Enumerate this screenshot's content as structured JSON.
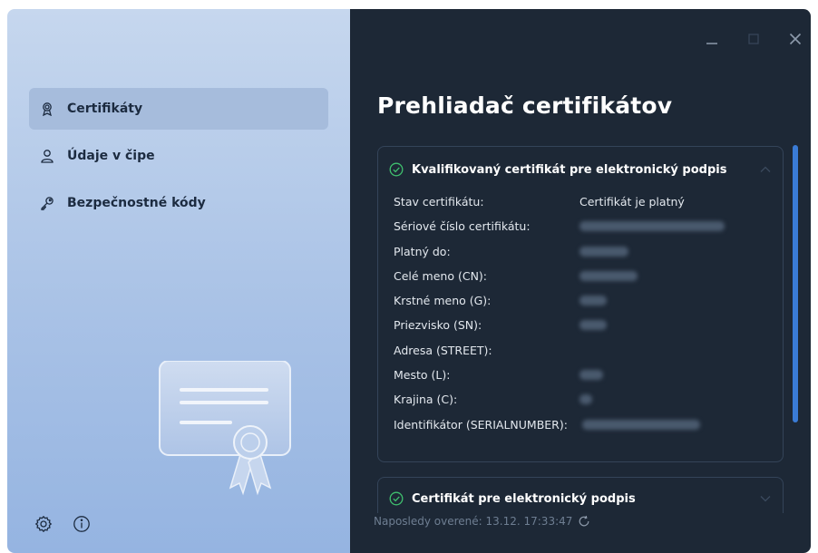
{
  "window": {
    "controls": [
      "minimize-icon",
      "maximize-icon",
      "close-icon"
    ]
  },
  "sidebar": {
    "items": [
      {
        "label": "Certifikáty",
        "icon": "certificate-icon",
        "active": true
      },
      {
        "label": "Údaje v čipe",
        "icon": "person-icon",
        "active": false
      },
      {
        "label": "Bezpečnostné kódy",
        "icon": "key-icon",
        "active": false
      }
    ],
    "bottom_icons": [
      "settings-icon",
      "info-icon"
    ]
  },
  "main": {
    "title": "Prehliadač certifikátov",
    "cards": [
      {
        "title": "Kvalifikovaný certifikát pre elektronický podpis",
        "expanded": true,
        "fields": [
          {
            "label": "Stav certifikátu:",
            "value": "Certifikát je platný"
          },
          {
            "label": "Sériové číslo certifikátu:",
            "value": "",
            "redacted": true
          },
          {
            "label": "Platný do:",
            "value": "",
            "redacted": true
          },
          {
            "label": "Celé meno (CN):",
            "value": "",
            "redacted": true
          },
          {
            "label": "Krstné meno (G):",
            "value": "",
            "redacted": true
          },
          {
            "label": "Priezvisko (SN):",
            "value": "",
            "redacted": true
          },
          {
            "label": "Adresa (STREET):",
            "value": ""
          },
          {
            "label": "Mesto (L):",
            "value": "",
            "redacted": true
          },
          {
            "label": "Krajina (C):",
            "value": "",
            "redacted": true
          },
          {
            "label": "Identifikátor (SERIALNUMBER):",
            "value": "",
            "redacted": true
          }
        ]
      },
      {
        "title": "Certifikát pre elektronický podpis",
        "expanded": false
      }
    ],
    "status": {
      "text": "Naposledy overené: 13.12. 17:33:47"
    }
  },
  "colors": {
    "accent": "#3a7bd5",
    "success": "#3fbf6e",
    "sidebar_bg": "#b4c9e8",
    "main_bg": "#1d2836"
  }
}
